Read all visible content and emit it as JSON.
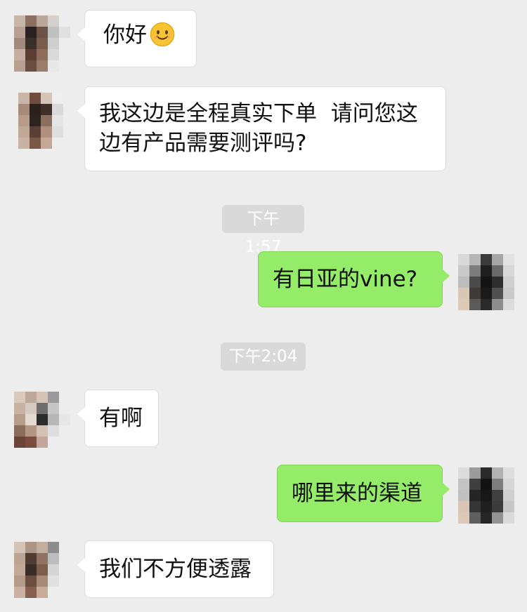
{
  "messages": [
    {
      "sender": "contact",
      "text": "你好",
      "emoji": "smiling-face-emoji"
    },
    {
      "sender": "contact",
      "text": "我这边是全程真实下单  请问您这边有产品需要测评吗?"
    },
    {
      "type": "timestamp",
      "text": "下午1:57"
    },
    {
      "sender": "self",
      "text": "有日亚的vine?"
    },
    {
      "type": "timestamp",
      "text": "下午2:04"
    },
    {
      "sender": "contact",
      "text": "有啊"
    },
    {
      "sender": "self",
      "text": "哪里来的渠道"
    },
    {
      "sender": "contact",
      "text": "我们不方便透露"
    }
  ],
  "colors": {
    "background": "#ededed",
    "incoming_bubble": "#ffffff",
    "outgoing_bubble": "#95ec69",
    "timestamp_pill": "#d9d9d9"
  }
}
